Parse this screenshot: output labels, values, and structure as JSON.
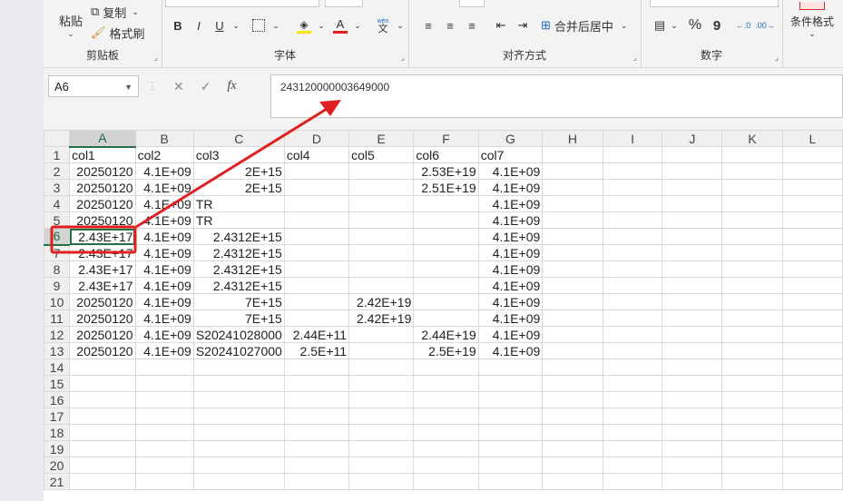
{
  "ribbon": {
    "clipboard": {
      "paste": "粘贴",
      "copy": "复制",
      "format_painter": "格式刷",
      "label": "剪贴板"
    },
    "font": {
      "label": "字体",
      "bold": "B",
      "italic": "I",
      "underline": "U",
      "font_color_letter": "A",
      "wen": "wén",
      "wen_char": "文"
    },
    "alignment": {
      "label": "对齐方式",
      "merge_center": "合并后居中"
    },
    "number": {
      "label": "数字",
      "percent": "%",
      "comma": "9"
    },
    "styles": {
      "conditional_format": "条件格式"
    }
  },
  "formula_bar": {
    "name_box": "A6",
    "cancel_icon": "✕",
    "enter_icon": "✓",
    "fx": "fx",
    "value": "243120000003649000"
  },
  "sheet": {
    "columns": [
      "A",
      "B",
      "C",
      "D",
      "E",
      "F",
      "G",
      "H",
      "I",
      "J",
      "K",
      "L"
    ],
    "active_column": "A",
    "active_row": "6",
    "rows": [
      {
        "n": "1",
        "cells": [
          "col1",
          "col2",
          "col3",
          "col4",
          "col5",
          "col6",
          "col7",
          "",
          "",
          "",
          "",
          ""
        ]
      },
      {
        "n": "2",
        "cells": [
          "20250120",
          "4.1E+09",
          "2E+15",
          "",
          "",
          "2.53E+19",
          "4.1E+09",
          "",
          "",
          "",
          "",
          ""
        ]
      },
      {
        "n": "3",
        "cells": [
          "20250120",
          "4.1E+09",
          "2E+15",
          "",
          "",
          "2.51E+19",
          "4.1E+09",
          "",
          "",
          "",
          "",
          ""
        ]
      },
      {
        "n": "4",
        "cells": [
          "20250120",
          "4.1E+09",
          "TR",
          "",
          "",
          "",
          "4.1E+09",
          "",
          "",
          "",
          "",
          ""
        ]
      },
      {
        "n": "5",
        "cells": [
          "20250120",
          "4.1E+09",
          "TR",
          "",
          "",
          "",
          "4.1E+09",
          "",
          "",
          "",
          "",
          ""
        ]
      },
      {
        "n": "6",
        "cells": [
          "2.43E+17",
          "4.1E+09",
          "2.4312E+15",
          "",
          "",
          "",
          "4.1E+09",
          "",
          "",
          "",
          "",
          ""
        ]
      },
      {
        "n": "7",
        "cells": [
          "2.43E+17",
          "4.1E+09",
          "2.4312E+15",
          "",
          "",
          "",
          "4.1E+09",
          "",
          "",
          "",
          "",
          ""
        ]
      },
      {
        "n": "8",
        "cells": [
          "2.43E+17",
          "4.1E+09",
          "2.4312E+15",
          "",
          "",
          "",
          "4.1E+09",
          "",
          "",
          "",
          "",
          ""
        ]
      },
      {
        "n": "9",
        "cells": [
          "2.43E+17",
          "4.1E+09",
          "2.4312E+15",
          "",
          "",
          "",
          "4.1E+09",
          "",
          "",
          "",
          "",
          ""
        ]
      },
      {
        "n": "10",
        "cells": [
          "20250120",
          "4.1E+09",
          "7E+15",
          "",
          "2.42E+19",
          "",
          "4.1E+09",
          "",
          "",
          "",
          "",
          ""
        ]
      },
      {
        "n": "11",
        "cells": [
          "20250120",
          "4.1E+09",
          "7E+15",
          "",
          "2.42E+19",
          "",
          "4.1E+09",
          "",
          "",
          "",
          "",
          ""
        ]
      },
      {
        "n": "12",
        "cells": [
          "20250120",
          "4.1E+09",
          "S20241028000",
          "2.44E+11",
          "",
          "2.44E+19",
          "4.1E+09",
          "",
          "",
          "",
          "",
          ""
        ]
      },
      {
        "n": "13",
        "cells": [
          "20250120",
          "4.1E+09",
          "S20241027000",
          "2.5E+11",
          "",
          "2.5E+19",
          "4.1E+09",
          "",
          "",
          "",
          "",
          ""
        ]
      },
      {
        "n": "14",
        "cells": [
          "",
          "",
          "",
          "",
          "",
          "",
          "",
          "",
          "",
          "",
          "",
          ""
        ]
      },
      {
        "n": "15",
        "cells": [
          "",
          "",
          "",
          "",
          "",
          "",
          "",
          "",
          "",
          "",
          "",
          ""
        ]
      },
      {
        "n": "16",
        "cells": [
          "",
          "",
          "",
          "",
          "",
          "",
          "",
          "",
          "",
          "",
          "",
          ""
        ]
      },
      {
        "n": "17",
        "cells": [
          "",
          "",
          "",
          "",
          "",
          "",
          "",
          "",
          "",
          "",
          "",
          ""
        ]
      },
      {
        "n": "18",
        "cells": [
          "",
          "",
          "",
          "",
          "",
          "",
          "",
          "",
          "",
          "",
          "",
          ""
        ]
      },
      {
        "n": "19",
        "cells": [
          "",
          "",
          "",
          "",
          "",
          "",
          "",
          "",
          "",
          "",
          "",
          ""
        ]
      },
      {
        "n": "20",
        "cells": [
          "",
          "",
          "",
          "",
          "",
          "",
          "",
          "",
          "",
          "",
          "",
          ""
        ]
      },
      {
        "n": "21",
        "cells": [
          "",
          "",
          "",
          "",
          "",
          "",
          "",
          "",
          "",
          "",
          "",
          ""
        ]
      }
    ],
    "text_cells": [
      "col1",
      "col2",
      "col3",
      "col4",
      "col5",
      "col6",
      "col7",
      "TR",
      "S20241028000",
      "S20241027000"
    ]
  },
  "annotation": {
    "color": "#e02020"
  }
}
